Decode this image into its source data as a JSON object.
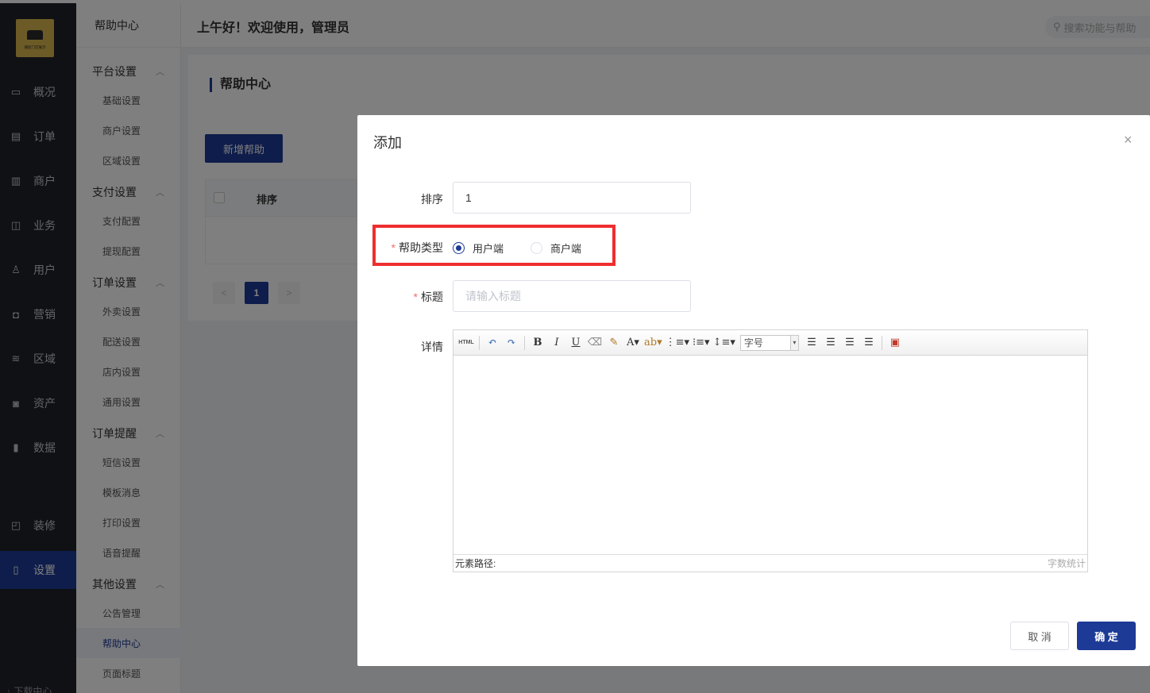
{
  "sidebar": {
    "logo_text": "捕捉门店展示",
    "items": [
      {
        "label": "概况",
        "icon": "dashboard-icon"
      },
      {
        "label": "订单",
        "icon": "order-icon"
      },
      {
        "label": "商户",
        "icon": "merchant-icon"
      },
      {
        "label": "业务",
        "icon": "business-icon"
      },
      {
        "label": "用户",
        "icon": "user-icon"
      },
      {
        "label": "营销",
        "icon": "marketing-icon"
      },
      {
        "label": "区域",
        "icon": "region-icon"
      },
      {
        "label": "资产",
        "icon": "asset-icon"
      },
      {
        "label": "数据",
        "icon": "data-chart-icon"
      },
      {
        "label": "装修",
        "icon": "decorate-icon"
      },
      {
        "label": "设置",
        "icon": "settings-icon"
      }
    ],
    "bottom_label": "下载中心"
  },
  "subnav": {
    "title": "帮助中心",
    "groups": [
      {
        "label": "平台设置",
        "items": [
          "基础设置",
          "商户设置",
          "区域设置"
        ]
      },
      {
        "label": "支付设置",
        "items": [
          "支付配置",
          "提现配置"
        ]
      },
      {
        "label": "订单设置",
        "items": [
          "外卖设置",
          "配送设置",
          "店内设置",
          "通用设置"
        ]
      },
      {
        "label": "订单提醒",
        "items": [
          "短信设置",
          "模板消息",
          "打印设置",
          "语音提醒"
        ]
      },
      {
        "label": "其他设置",
        "items": [
          "公告管理",
          "帮助中心",
          "页面标题"
        ]
      }
    ],
    "active_item": "帮助中心"
  },
  "header": {
    "greeting": "上午好！欢迎使用，管理员",
    "search_placeholder": "搜索功能与帮助"
  },
  "main": {
    "page_title": "帮助中心",
    "add_button": "新增帮助",
    "table_headers": [
      "排序"
    ],
    "pager": {
      "prev": "<",
      "current": "1",
      "next": ">"
    }
  },
  "dialog": {
    "title": "添加",
    "close": "×",
    "fields": {
      "sort_label": "排序",
      "sort_value": "1",
      "type_label": "帮助类型",
      "type_options": [
        "用户端",
        "商户端"
      ],
      "type_selected": "用户端",
      "title_label": "标题",
      "title_placeholder": "请输入标题",
      "detail_label": "详情"
    },
    "editor": {
      "html_button": "HTML",
      "font_size_select": "字号",
      "path_label": "元素路径:",
      "word_count": "字数统计"
    },
    "cancel": "取 消",
    "confirm": "确 定"
  },
  "colors": {
    "primary": "#1d3a96",
    "sidebar_bg": "#20222a",
    "highlight_box": "#ef2e2e",
    "required": "#f56c6c"
  }
}
